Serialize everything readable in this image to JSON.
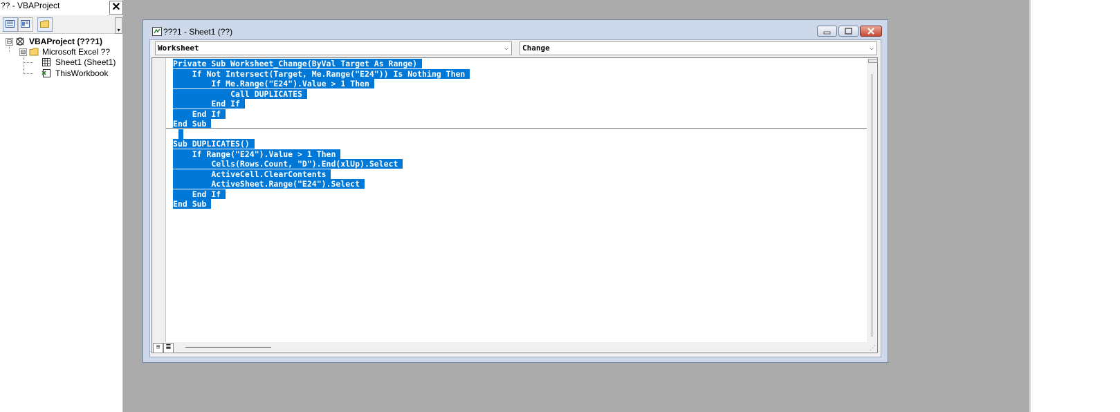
{
  "project_explorer": {
    "title": "?? - VBAProject",
    "close_glyph": "✕",
    "toolbar": {
      "buttons": [
        "view-code-icon",
        "view-object-icon",
        "toggle-folders-icon"
      ]
    },
    "tree": [
      {
        "label": "VBAProject (???1)",
        "icon": "vba-project-icon",
        "level": 0,
        "expander": "⊟"
      },
      {
        "label": "Microsoft Excel ??",
        "icon": "folder-icon",
        "level": 1,
        "expander": "⊟"
      },
      {
        "label": "Sheet1 (Sheet1)",
        "icon": "worksheet-icon",
        "level": 2
      },
      {
        "label": "ThisWorkbook",
        "icon": "workbook-icon",
        "level": 2
      }
    ]
  },
  "code_window": {
    "title": "???1 - Sheet1 (??)",
    "object_combo": "Worksheet",
    "procedure_combo": "Change",
    "combo_arrow": "⌵",
    "selection_color": "#0078d7",
    "procedure_1": [
      "Private Sub Worksheet_Change(ByVal Target As Range) ",
      "    If Not Intersect(Target, Me.Range(\"E24\")) Is Nothing Then ",
      "        If Me.Range(\"E24\").Value > 1 Then ",
      "            Call DUPLICATES ",
      "        End If ",
      "    End If ",
      "End Sub "
    ],
    "blank_line": " ",
    "procedure_2": [
      "Sub DUPLICATES() ",
      "    If Range(\"E24\").Value > 1 Then ",
      "        Cells(Rows.Count, \"D\").End(xlUp).Select ",
      "        ActiveCell.ClearContents ",
      "        ActiveSheet.Range(\"E24\").Select ",
      "    End If ",
      "End Sub "
    ]
  }
}
